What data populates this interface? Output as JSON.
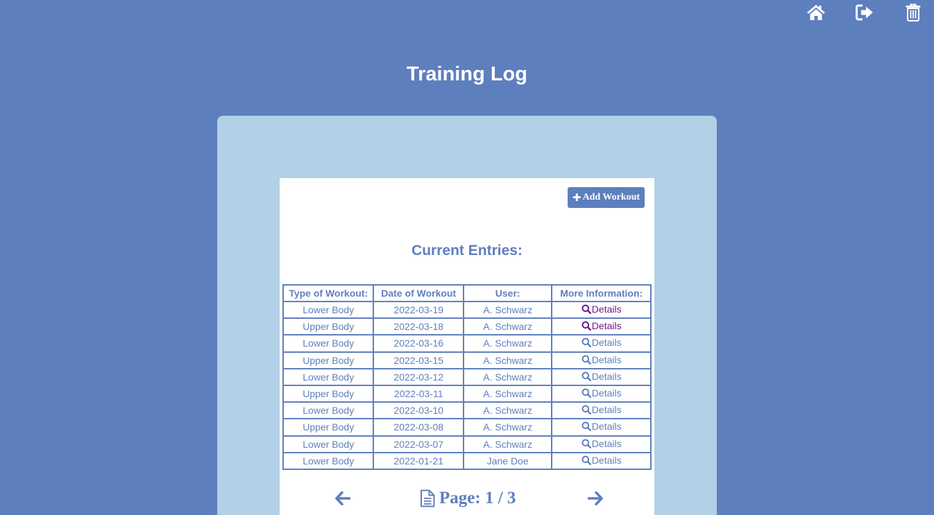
{
  "page": {
    "title": "Training Log"
  },
  "nav": {
    "icons": [
      "home-icon",
      "sign-out-icon",
      "trash-icon"
    ]
  },
  "colors": {
    "background": "#5e7fbd",
    "panel": "#b2d0e6",
    "accent": "#5e7fbd",
    "visited": "#6b1a8c"
  },
  "toolbar": {
    "add_label": "Add Workout",
    "add_icon": "plus-icon"
  },
  "entries": {
    "heading": "Current Entries:",
    "columns": [
      "Type of Workout:",
      "Date of Workout",
      "User:",
      "More Information:"
    ],
    "rows": [
      {
        "type": "Lower Body",
        "date": "2022-03-19",
        "user": "A. Schwarz",
        "info": "Details",
        "visited": true
      },
      {
        "type": "Upper Body",
        "date": "2022-03-18",
        "user": "A. Schwarz",
        "info": "Details",
        "visited": true
      },
      {
        "type": "Lower Body",
        "date": "2022-03-16",
        "user": "A. Schwarz",
        "info": "Details",
        "visited": false
      },
      {
        "type": "Upper Body",
        "date": "2022-03-15",
        "user": "A. Schwarz",
        "info": "Details",
        "visited": false
      },
      {
        "type": "Lower Body",
        "date": "2022-03-12",
        "user": "A. Schwarz",
        "info": "Details",
        "visited": false
      },
      {
        "type": "Upper Body",
        "date": "2022-03-11",
        "user": "A. Schwarz",
        "info": "Details",
        "visited": false
      },
      {
        "type": "Lower Body",
        "date": "2022-03-10",
        "user": "A. Schwarz",
        "info": "Details",
        "visited": false
      },
      {
        "type": "Upper Body",
        "date": "2022-03-08",
        "user": "A. Schwarz",
        "info": "Details",
        "visited": false
      },
      {
        "type": "Lower Body",
        "date": "2022-03-07",
        "user": "A. Schwarz",
        "info": "Details",
        "visited": false
      },
      {
        "type": "Lower Body",
        "date": "2022-01-21",
        "user": "Jane Doe",
        "info": "Details",
        "visited": false
      }
    ]
  },
  "pager": {
    "label": "Page: 1 / 3"
  }
}
